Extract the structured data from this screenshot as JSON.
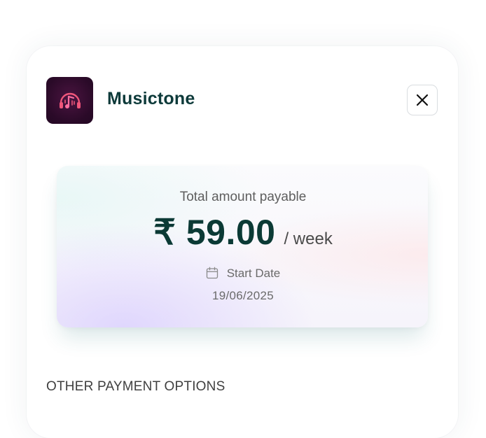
{
  "app": {
    "name": "Musictone",
    "logo_icon": "music-note-headphones-icon",
    "logo_colors": [
      "#2a0a28",
      "#f0567a"
    ]
  },
  "close_icon": "close-icon",
  "payment": {
    "label": "Total amount payable",
    "amount": "₹ 59.00",
    "period": "/ week",
    "start_label": "Start Date",
    "start_icon": "calendar-icon",
    "start_date": "19/06/2025"
  },
  "other_options": {
    "title": "OTHER PAYMENT OPTIONS"
  },
  "colors": {
    "brand_dark": "#0b3a35",
    "text_muted": "#6a6a6a"
  }
}
